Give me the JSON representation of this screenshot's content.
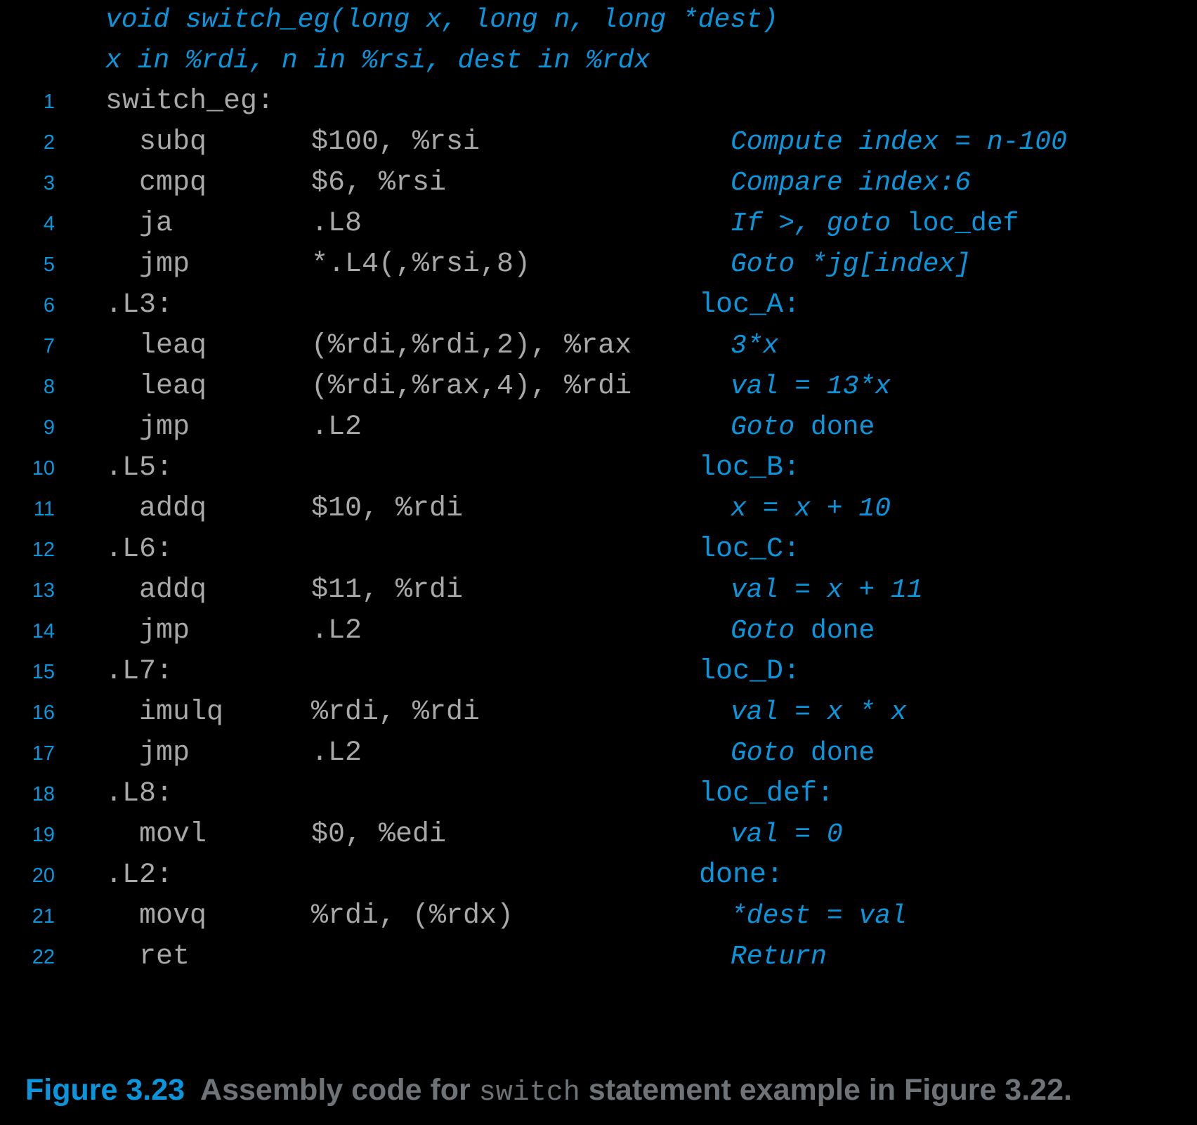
{
  "colors": {
    "background": "#000000",
    "line_number": "#0a96dc",
    "code_text": "#a8a8a8",
    "comment_text": "#0a96dc",
    "caption_figure": "#0a96dc",
    "caption_text": "#6e7377"
  },
  "header_lines": [
    "void switch_eg(long x, long n, long *dest)",
    "x in %rdi, n in %rsi, dest in %rdx"
  ],
  "rows": [
    {
      "n": "1",
      "mnemonic": "switch_eg:",
      "operands": "",
      "kind": "label",
      "comment": "",
      "comment_kind": "none"
    },
    {
      "n": "2",
      "mnemonic": "subq",
      "operands": "$100, %rsi",
      "kind": "instr",
      "comment": "Compute index = n-100",
      "comment_kind": "italic"
    },
    {
      "n": "3",
      "mnemonic": "cmpq",
      "operands": "$6, %rsi",
      "kind": "instr",
      "comment": "Compare index:6",
      "comment_kind": "italic"
    },
    {
      "n": "4",
      "mnemonic": "ja",
      "operands": ".L8",
      "kind": "instr",
      "comment": "If >, goto ",
      "comment_kind": "italic-roman",
      "comment_roman": "loc_def"
    },
    {
      "n": "5",
      "mnemonic": "jmp",
      "operands": "*.L4(,%rsi,8)",
      "kind": "instr",
      "comment": "Goto *jg[index]",
      "comment_kind": "italic"
    },
    {
      "n": "6",
      "mnemonic": ".L3:",
      "operands": "",
      "kind": "label",
      "comment": "loc_A:",
      "comment_kind": "label"
    },
    {
      "n": "7",
      "mnemonic": "leaq",
      "operands": "(%rdi,%rdi,2), %rax",
      "kind": "instr",
      "comment": "3*x",
      "comment_kind": "italic"
    },
    {
      "n": "8",
      "mnemonic": "leaq",
      "operands": "(%rdi,%rax,4), %rdi",
      "kind": "instr",
      "comment": "val = 13*x",
      "comment_kind": "italic"
    },
    {
      "n": "9",
      "mnemonic": "jmp",
      "operands": ".L2",
      "kind": "instr",
      "comment": "Goto ",
      "comment_kind": "italic-roman",
      "comment_roman": "done"
    },
    {
      "n": "10",
      "mnemonic": ".L5:",
      "operands": "",
      "kind": "label",
      "comment": "loc_B:",
      "comment_kind": "label"
    },
    {
      "n": "11",
      "mnemonic": "addq",
      "operands": "$10, %rdi",
      "kind": "instr",
      "comment": "x = x + 10",
      "comment_kind": "italic"
    },
    {
      "n": "12",
      "mnemonic": ".L6:",
      "operands": "",
      "kind": "label",
      "comment": "loc_C:",
      "comment_kind": "label"
    },
    {
      "n": "13",
      "mnemonic": "addq",
      "operands": "$11, %rdi",
      "kind": "instr",
      "comment": "val = x + 11",
      "comment_kind": "italic"
    },
    {
      "n": "14",
      "mnemonic": "jmp",
      "operands": ".L2",
      "kind": "instr",
      "comment": "Goto ",
      "comment_kind": "italic-roman",
      "comment_roman": "done"
    },
    {
      "n": "15",
      "mnemonic": ".L7:",
      "operands": "",
      "kind": "label",
      "comment": "loc_D:",
      "comment_kind": "label"
    },
    {
      "n": "16",
      "mnemonic": "imulq",
      "operands": "%rdi, %rdi",
      "kind": "instr",
      "comment": "val = x * x",
      "comment_kind": "italic"
    },
    {
      "n": "17",
      "mnemonic": "jmp",
      "operands": ".L2",
      "kind": "instr",
      "comment": "Goto ",
      "comment_kind": "italic-roman",
      "comment_roman": "done"
    },
    {
      "n": "18",
      "mnemonic": ".L8:",
      "operands": "",
      "kind": "label",
      "comment": "loc_def:",
      "comment_kind": "label"
    },
    {
      "n": "19",
      "mnemonic": "movl",
      "operands": "$0, %edi",
      "kind": "instr",
      "comment": "val = 0",
      "comment_kind": "italic"
    },
    {
      "n": "20",
      "mnemonic": ".L2:",
      "operands": "",
      "kind": "label",
      "comment": "done:",
      "comment_kind": "label"
    },
    {
      "n": "21",
      "mnemonic": "movq",
      "operands": "%rdi, (%rdx)",
      "kind": "instr",
      "comment": "*dest = val",
      "comment_kind": "italic"
    },
    {
      "n": "22",
      "mnemonic": "ret",
      "operands": "",
      "kind": "instr",
      "comment": "Return",
      "comment_kind": "italic"
    }
  ],
  "caption": {
    "figure_number": "Figure 3.23",
    "part1": "Assembly code for ",
    "mono": "switch",
    "part2": " statement example in Figure 3.22."
  }
}
